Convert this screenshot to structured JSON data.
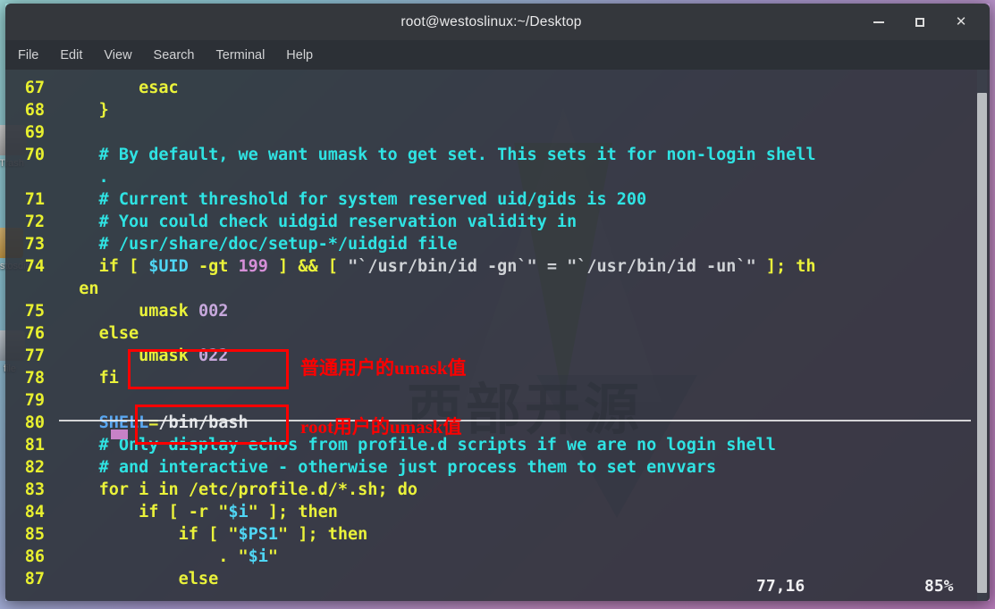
{
  "window": {
    "title": "root@westoslinux:~/Desktop",
    "controls": [
      {
        "name": "minimize-button",
        "glyph": "–"
      },
      {
        "name": "maximize-button",
        "glyph": "□"
      },
      {
        "name": "close-button",
        "glyph": "✕"
      }
    ]
  },
  "menubar": {
    "items": [
      "File",
      "Edit",
      "View",
      "Search",
      "Terminal",
      "Help"
    ]
  },
  "desktop": {
    "watermark": "西部开源",
    "icons": [
      {
        "label": "Trash"
      },
      {
        "label": "westosdir"
      },
      {
        "label": "file"
      }
    ]
  },
  "editor": {
    "lines": [
      {
        "no": "67",
        "text": "        esac"
      },
      {
        "no": "68",
        "text": "    }"
      },
      {
        "no": "69",
        "text": ""
      },
      {
        "no": "70",
        "text": "    # By default, we want umask to get set. This sets it for non-login shell"
      },
      {
        "no": "",
        "text": "    ."
      },
      {
        "no": "71",
        "text": "    # Current threshold for system reserved uid/gids is 200"
      },
      {
        "no": "72",
        "text": "    # You could check uidgid reservation validity in"
      },
      {
        "no": "73",
        "text": "    # /usr/share/doc/setup-*/uidgid file"
      },
      {
        "no": "74",
        "text": "    if [ $UID -gt 199 ] && [ \"`/usr/bin/id -gn`\" = \"`/usr/bin/id -un`\" ]; th"
      },
      {
        "no": "",
        "text": "  en"
      },
      {
        "no": "75",
        "text": "        umask 002"
      },
      {
        "no": "76",
        "text": "    else"
      },
      {
        "no": "77",
        "text": "        umask 022"
      },
      {
        "no": "78",
        "text": "    fi"
      },
      {
        "no": "79",
        "text": ""
      },
      {
        "no": "80",
        "text": "    SHELL=/bin/bash"
      },
      {
        "no": "81",
        "text": "    # Only display echos from profile.d scripts if we are no login shell"
      },
      {
        "no": "82",
        "text": "    # and interactive - otherwise just process them to set envvars"
      },
      {
        "no": "83",
        "text": "    for i in /etc/profile.d/*.sh; do"
      },
      {
        "no": "84",
        "text": "        if [ -r \"$i\" ]; then"
      },
      {
        "no": "85",
        "text": "            if [ \"$PS1\" ]; then"
      },
      {
        "no": "86",
        "text": "                . \"$i\""
      },
      {
        "no": "87",
        "text": "            else"
      }
    ]
  },
  "statusline": {
    "ruler": "77,16",
    "percent": "85%"
  },
  "annotations": [
    {
      "text": "普通用户的umask值",
      "target": "umask 002"
    },
    {
      "text": "root用户的umask值",
      "target": "umask 022"
    }
  ],
  "colors": {
    "comment": "#2fe3e3",
    "keyword": "#eaf23a",
    "variable": "#4fd6f5",
    "number": "#d58fd8",
    "lineno": "#e8f02f",
    "annotation": "#ff0000",
    "terminal_bg": "#2c3139"
  }
}
